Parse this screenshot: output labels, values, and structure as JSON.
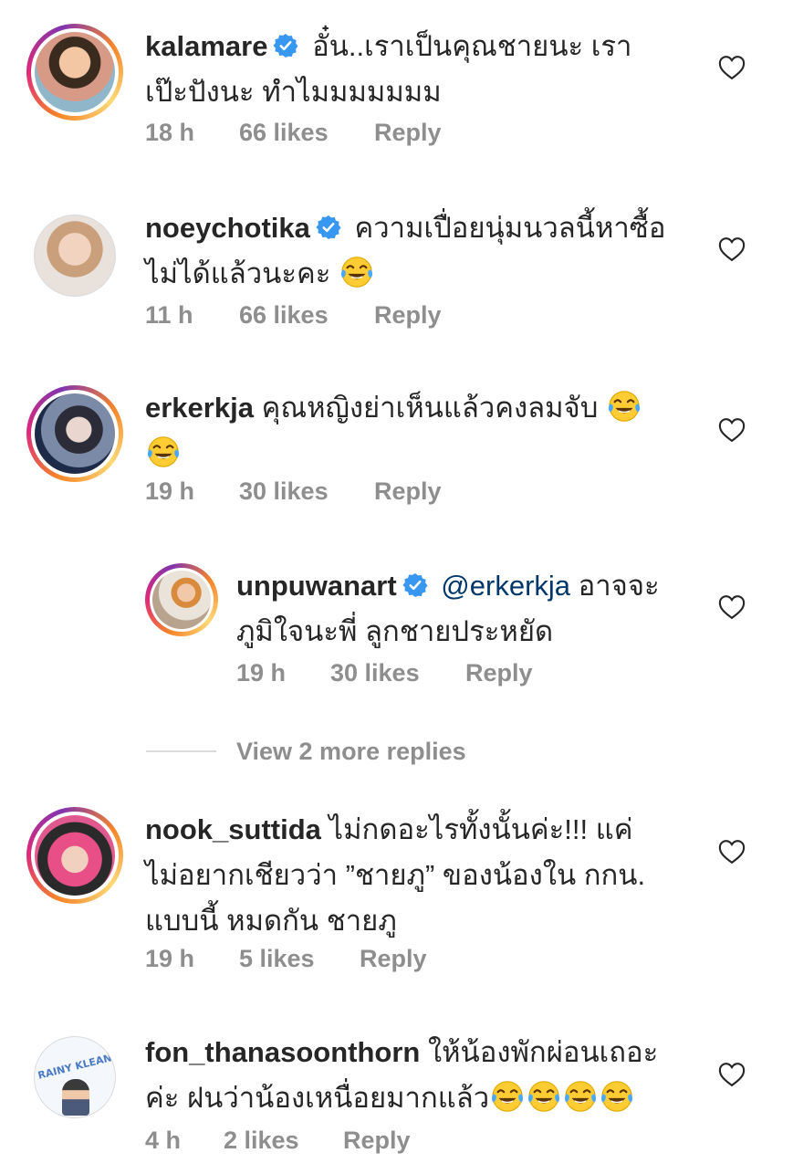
{
  "comments": [
    {
      "username": "kalamare",
      "verified": true,
      "text_line1": "อั๋น..เราเป็นคุณชายนะ  เรา",
      "text_line2": "เป๊ะปังนะ ทำไมมมมมมม",
      "time": "18 h",
      "likes": "66 likes",
      "reply": "Reply"
    },
    {
      "username": "noeychotika",
      "verified": true,
      "text_line1": "ความเปื่อยนุ่มนวลนี้หาซื้อ",
      "text_line2": "ไม่ได้แล้วนะคะ",
      "emoji": "face-with-tears-of-joy",
      "time": "11 h",
      "likes": "66 likes",
      "reply": "Reply"
    },
    {
      "username": "erkerkja",
      "verified": false,
      "text_line1": "คุณหญิงย่าเห็นแล้วคงลมจับ",
      "emoji": "face-with-tears-of-joy",
      "time": "19 h",
      "likes": "30 likes",
      "reply": "Reply"
    },
    {
      "username": "unpuwanart",
      "verified": true,
      "mention": "@erkerkja",
      "text_line1": "อาจจะ",
      "text_line2": "ภูมิใจนะพี่ ลูกชายประหยัด",
      "time": "19 h",
      "likes": "30 likes",
      "reply": "Reply"
    },
    {
      "username": "nook_suttida",
      "verified": false,
      "text_line1": "ไม่กดอะไรทั้งนั้นค่ะ!!! แค่",
      "text_line2": "ไม่อยากเชียวว่า ”ชายภู” ของน้องใน กกน.",
      "text_line3": "แบบนี้ หมดกัน ชายภู",
      "time": "19 h",
      "likes": "5 likes",
      "reply": "Reply"
    },
    {
      "username": "fon_thanasoonthorn",
      "verified": false,
      "text_line1": "ให้น้องพักผ่อนเถอะ",
      "text_line2": "ค่ะ ฝนว่าน้องเหนื่อยมากแล้ว",
      "emoji": "face-with-tears-of-joy",
      "time": "4 h",
      "likes": "2 likes",
      "reply": "Reply"
    }
  ],
  "view_more_replies": "View 2 more replies",
  "avatar_text": "RAINY KLEAN",
  "colors": {
    "verified": "#3897f0",
    "meta": "#8e8e8e",
    "mention": "#00376b",
    "text": "#262626"
  }
}
